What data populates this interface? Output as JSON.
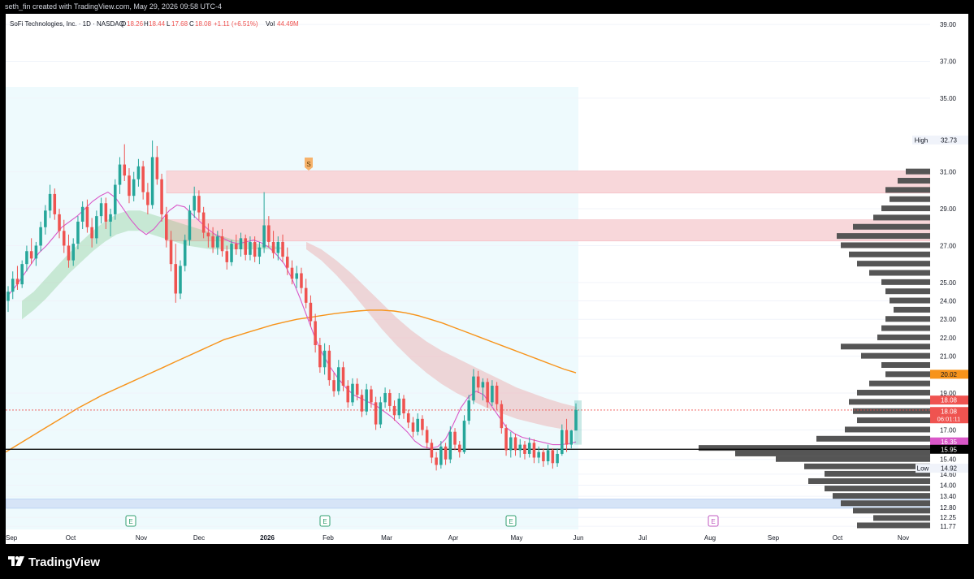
{
  "topbar": {
    "credit": "seth_fin created with TradingView.com, May 29, 2026 09:58 UTC-4"
  },
  "header": {
    "symbol": "SoFi Technologies, Inc. · 1D · NASDAQ",
    "o_label": "O",
    "o_value": "18.26",
    "h_label": "H",
    "h_value": "18.44",
    "l_label": "L",
    "l_value": "17.68",
    "c_label": "C",
    "c_value": "18.08",
    "change": "+1.11 (+6.51%)",
    "vol_label": "Vol",
    "vol_value": "44.49M"
  },
  "branding": {
    "logo_text": "TradingView"
  },
  "colors": {
    "up": "#26a69a",
    "down": "#ef5350",
    "ema": "#f7931a",
    "fast_ma": "#d957c8",
    "volume_profile": "#555555",
    "support_line": "#000000",
    "resistance_zone": "#f8d7da",
    "demand_zone": "#d6e4f7",
    "highlight_bg": "#eefafd"
  },
  "chart_data": {
    "type": "candlestick",
    "title": "SoFi Technologies, Inc. · 1D · NASDAQ",
    "y_ticks": [
      "39.00",
      "37.00",
      "35.00",
      "31.00",
      "29.00",
      "27.00",
      "25.00",
      "24.00",
      "23.00",
      "22.00",
      "21.00",
      "19.00",
      "17.00",
      "15.40",
      "14.60",
      "14.00",
      "13.40",
      "12.80",
      "12.25",
      "11.77"
    ],
    "x_ticks": [
      "Sep",
      "Oct",
      "Nov",
      "Dec",
      "2026",
      "Feb",
      "Mar",
      "Apr",
      "May",
      "Jun",
      "Jul",
      "Aug",
      "Sep",
      "Oct",
      "Nov"
    ],
    "ylim": [
      11.6,
      39.4
    ],
    "price_labels": {
      "high_label": "High",
      "high_value": "32.73",
      "low_label": "Low",
      "low_value": "14.92",
      "ema_value": "20.02",
      "last_price": "18.08",
      "last_price_2": "18.08",
      "countdown": "06:01:11",
      "fast_ma_value": "16.35",
      "support_value": "15.95"
    },
    "support_level": 15.95,
    "resistance_zones": [
      [
        29.85,
        31.05
      ],
      [
        27.25,
        28.4
      ]
    ],
    "demand_zone": [
      12.75,
      13.25
    ],
    "signal_marker": "S",
    "earnings_markers": [
      "E",
      "E",
      "E",
      "E"
    ],
    "candles": [
      {
        "o": 24.0,
        "h": 24.8,
        "l": 23.4,
        "c": 24.5
      },
      {
        "o": 24.5,
        "h": 25.6,
        "l": 24.1,
        "c": 25.2
      },
      {
        "o": 25.2,
        "h": 25.9,
        "l": 24.6,
        "c": 24.9
      },
      {
        "o": 24.9,
        "h": 26.2,
        "l": 24.7,
        "c": 26.0
      },
      {
        "o": 26.0,
        "h": 27.0,
        "l": 25.6,
        "c": 26.7
      },
      {
        "o": 26.7,
        "h": 27.4,
        "l": 26.0,
        "c": 26.3
      },
      {
        "o": 26.3,
        "h": 27.2,
        "l": 25.9,
        "c": 27.0
      },
      {
        "o": 27.0,
        "h": 28.3,
        "l": 26.7,
        "c": 28.0
      },
      {
        "o": 28.0,
        "h": 29.2,
        "l": 27.6,
        "c": 28.9
      },
      {
        "o": 28.9,
        "h": 30.3,
        "l": 28.5,
        "c": 29.8
      },
      {
        "o": 29.8,
        "h": 30.1,
        "l": 28.4,
        "c": 28.7
      },
      {
        "o": 28.7,
        "h": 29.0,
        "l": 27.4,
        "c": 27.8
      },
      {
        "o": 27.8,
        "h": 28.4,
        "l": 26.6,
        "c": 27.0
      },
      {
        "o": 27.0,
        "h": 27.6,
        "l": 25.8,
        "c": 26.2
      },
      {
        "o": 26.2,
        "h": 27.4,
        "l": 25.9,
        "c": 27.1
      },
      {
        "o": 27.1,
        "h": 28.6,
        "l": 26.8,
        "c": 28.3
      },
      {
        "o": 28.3,
        "h": 29.4,
        "l": 27.9,
        "c": 29.1
      },
      {
        "o": 29.1,
        "h": 29.5,
        "l": 27.7,
        "c": 28.0
      },
      {
        "o": 28.0,
        "h": 28.5,
        "l": 26.9,
        "c": 27.4
      },
      {
        "o": 27.4,
        "h": 28.9,
        "l": 27.1,
        "c": 28.6
      },
      {
        "o": 28.6,
        "h": 29.6,
        "l": 28.2,
        "c": 29.3
      },
      {
        "o": 29.3,
        "h": 29.6,
        "l": 27.9,
        "c": 28.3
      },
      {
        "o": 28.3,
        "h": 29.0,
        "l": 27.5,
        "c": 28.7
      },
      {
        "o": 28.7,
        "h": 30.6,
        "l": 28.4,
        "c": 30.3
      },
      {
        "o": 30.3,
        "h": 31.8,
        "l": 29.8,
        "c": 31.4
      },
      {
        "o": 31.4,
        "h": 32.5,
        "l": 30.5,
        "c": 30.8
      },
      {
        "o": 30.8,
        "h": 31.2,
        "l": 29.3,
        "c": 29.7
      },
      {
        "o": 29.7,
        "h": 31.0,
        "l": 29.4,
        "c": 30.6
      },
      {
        "o": 30.6,
        "h": 31.7,
        "l": 30.2,
        "c": 31.3
      },
      {
        "o": 31.3,
        "h": 31.6,
        "l": 29.5,
        "c": 29.9
      },
      {
        "o": 29.9,
        "h": 30.4,
        "l": 28.7,
        "c": 29.2
      },
      {
        "o": 29.2,
        "h": 32.7,
        "l": 29.0,
        "c": 31.8
      },
      {
        "o": 31.8,
        "h": 32.4,
        "l": 30.3,
        "c": 30.6
      },
      {
        "o": 30.6,
        "h": 30.9,
        "l": 28.3,
        "c": 28.7
      },
      {
        "o": 28.7,
        "h": 29.1,
        "l": 26.9,
        "c": 27.3
      },
      {
        "o": 27.3,
        "h": 27.8,
        "l": 25.6,
        "c": 26.0
      },
      {
        "o": 26.0,
        "h": 27.1,
        "l": 23.9,
        "c": 24.4
      },
      {
        "o": 24.4,
        "h": 26.2,
        "l": 24.1,
        "c": 25.9
      },
      {
        "o": 25.9,
        "h": 27.6,
        "l": 25.6,
        "c": 27.3
      },
      {
        "o": 27.3,
        "h": 29.2,
        "l": 27.0,
        "c": 28.9
      },
      {
        "o": 28.9,
        "h": 30.2,
        "l": 28.5,
        "c": 29.7
      },
      {
        "o": 29.7,
        "h": 30.0,
        "l": 28.4,
        "c": 28.8
      },
      {
        "o": 28.8,
        "h": 29.1,
        "l": 27.4,
        "c": 27.7
      },
      {
        "o": 27.7,
        "h": 28.2,
        "l": 26.9,
        "c": 27.5
      },
      {
        "o": 27.5,
        "h": 28.0,
        "l": 26.6,
        "c": 26.9
      },
      {
        "o": 26.9,
        "h": 27.8,
        "l": 26.5,
        "c": 27.5
      },
      {
        "o": 27.5,
        "h": 27.9,
        "l": 26.4,
        "c": 26.7
      },
      {
        "o": 26.7,
        "h": 27.0,
        "l": 25.7,
        "c": 26.1
      },
      {
        "o": 26.1,
        "h": 27.3,
        "l": 25.9,
        "c": 27.1
      },
      {
        "o": 27.1,
        "h": 27.6,
        "l": 26.5,
        "c": 26.8
      },
      {
        "o": 26.8,
        "h": 27.7,
        "l": 26.4,
        "c": 27.4
      },
      {
        "o": 27.4,
        "h": 27.6,
        "l": 26.2,
        "c": 26.5
      },
      {
        "o": 26.5,
        "h": 27.5,
        "l": 26.2,
        "c": 27.2
      },
      {
        "o": 27.2,
        "h": 27.5,
        "l": 26.1,
        "c": 26.4
      },
      {
        "o": 26.4,
        "h": 27.2,
        "l": 26.0,
        "c": 26.9
      },
      {
        "o": 26.9,
        "h": 29.9,
        "l": 26.6,
        "c": 28.1
      },
      {
        "o": 28.1,
        "h": 28.6,
        "l": 26.9,
        "c": 27.2
      },
      {
        "o": 27.2,
        "h": 27.8,
        "l": 26.3,
        "c": 26.6
      },
      {
        "o": 26.6,
        "h": 27.5,
        "l": 26.2,
        "c": 27.2
      },
      {
        "o": 27.2,
        "h": 27.6,
        "l": 26.1,
        "c": 26.4
      },
      {
        "o": 26.4,
        "h": 26.9,
        "l": 25.4,
        "c": 25.8
      },
      {
        "o": 25.8,
        "h": 26.2,
        "l": 24.9,
        "c": 25.2
      },
      {
        "o": 25.2,
        "h": 25.9,
        "l": 24.7,
        "c": 25.5
      },
      {
        "o": 25.5,
        "h": 25.8,
        "l": 24.4,
        "c": 24.7
      },
      {
        "o": 24.7,
        "h": 25.2,
        "l": 23.6,
        "c": 23.9
      },
      {
        "o": 23.9,
        "h": 24.3,
        "l": 22.6,
        "c": 22.9
      },
      {
        "o": 22.9,
        "h": 23.3,
        "l": 21.2,
        "c": 21.6
      },
      {
        "o": 21.6,
        "h": 22.0,
        "l": 20.1,
        "c": 20.4
      },
      {
        "o": 20.4,
        "h": 21.7,
        "l": 20.0,
        "c": 21.3
      },
      {
        "o": 21.3,
        "h": 21.6,
        "l": 19.4,
        "c": 19.7
      },
      {
        "o": 19.7,
        "h": 20.1,
        "l": 18.8,
        "c": 19.1
      },
      {
        "o": 19.1,
        "h": 20.8,
        "l": 18.9,
        "c": 20.4
      },
      {
        "o": 20.4,
        "h": 20.7,
        "l": 19.1,
        "c": 19.4
      },
      {
        "o": 19.4,
        "h": 19.7,
        "l": 18.2,
        "c": 18.5
      },
      {
        "o": 18.5,
        "h": 19.8,
        "l": 18.3,
        "c": 19.5
      },
      {
        "o": 19.5,
        "h": 19.8,
        "l": 18.6,
        "c": 18.9
      },
      {
        "o": 18.9,
        "h": 19.2,
        "l": 17.7,
        "c": 18.0
      },
      {
        "o": 18.0,
        "h": 19.5,
        "l": 17.8,
        "c": 19.2
      },
      {
        "o": 19.2,
        "h": 19.4,
        "l": 18.2,
        "c": 18.5
      },
      {
        "o": 18.5,
        "h": 18.8,
        "l": 17.0,
        "c": 17.3
      },
      {
        "o": 17.3,
        "h": 18.8,
        "l": 17.1,
        "c": 18.5
      },
      {
        "o": 18.5,
        "h": 19.3,
        "l": 18.2,
        "c": 19.0
      },
      {
        "o": 19.0,
        "h": 19.2,
        "l": 18.0,
        "c": 18.3
      },
      {
        "o": 18.3,
        "h": 18.6,
        "l": 17.5,
        "c": 17.8
      },
      {
        "o": 17.8,
        "h": 19.0,
        "l": 17.6,
        "c": 18.7
      },
      {
        "o": 18.7,
        "h": 18.9,
        "l": 17.6,
        "c": 17.9
      },
      {
        "o": 17.9,
        "h": 18.1,
        "l": 17.1,
        "c": 17.4
      },
      {
        "o": 17.4,
        "h": 17.7,
        "l": 16.6,
        "c": 16.9
      },
      {
        "o": 16.9,
        "h": 17.9,
        "l": 16.7,
        "c": 17.6
      },
      {
        "o": 17.6,
        "h": 17.8,
        "l": 16.7,
        "c": 17.0
      },
      {
        "o": 17.0,
        "h": 17.2,
        "l": 16.0,
        "c": 16.3
      },
      {
        "o": 16.3,
        "h": 16.5,
        "l": 15.2,
        "c": 15.5
      },
      {
        "o": 15.5,
        "h": 15.8,
        "l": 14.8,
        "c": 15.1
      },
      {
        "o": 15.1,
        "h": 16.4,
        "l": 14.9,
        "c": 16.1
      },
      {
        "o": 16.1,
        "h": 16.3,
        "l": 15.1,
        "c": 15.4
      },
      {
        "o": 15.4,
        "h": 17.2,
        "l": 15.2,
        "c": 16.9
      },
      {
        "o": 16.9,
        "h": 17.1,
        "l": 15.9,
        "c": 16.2
      },
      {
        "o": 16.2,
        "h": 16.4,
        "l": 15.5,
        "c": 15.8
      },
      {
        "o": 15.8,
        "h": 17.8,
        "l": 15.7,
        "c": 17.5
      },
      {
        "o": 17.5,
        "h": 18.9,
        "l": 17.3,
        "c": 18.6
      },
      {
        "o": 18.6,
        "h": 20.3,
        "l": 18.4,
        "c": 19.9
      },
      {
        "o": 19.9,
        "h": 20.2,
        "l": 19.0,
        "c": 19.3
      },
      {
        "o": 19.3,
        "h": 19.8,
        "l": 18.6,
        "c": 19.6
      },
      {
        "o": 19.6,
        "h": 19.8,
        "l": 18.2,
        "c": 18.5
      },
      {
        "o": 18.5,
        "h": 19.7,
        "l": 18.3,
        "c": 19.4
      },
      {
        "o": 19.4,
        "h": 19.6,
        "l": 18.1,
        "c": 18.4
      },
      {
        "o": 18.4,
        "h": 18.6,
        "l": 16.8,
        "c": 17.1
      },
      {
        "o": 17.1,
        "h": 17.3,
        "l": 15.6,
        "c": 15.9
      },
      {
        "o": 15.9,
        "h": 16.9,
        "l": 15.5,
        "c": 16.6
      },
      {
        "o": 16.6,
        "h": 16.8,
        "l": 15.6,
        "c": 15.9
      },
      {
        "o": 15.9,
        "h": 16.5,
        "l": 15.5,
        "c": 16.2
      },
      {
        "o": 16.2,
        "h": 16.4,
        "l": 15.4,
        "c": 15.7
      },
      {
        "o": 15.7,
        "h": 16.6,
        "l": 15.5,
        "c": 16.3
      },
      {
        "o": 16.3,
        "h": 16.5,
        "l": 15.2,
        "c": 15.5
      },
      {
        "o": 15.5,
        "h": 16.1,
        "l": 15.2,
        "c": 15.8
      },
      {
        "o": 15.8,
        "h": 16.0,
        "l": 15.0,
        "c": 15.3
      },
      {
        "o": 15.3,
        "h": 16.2,
        "l": 15.1,
        "c": 15.9
      },
      {
        "o": 15.9,
        "h": 16.0,
        "l": 14.9,
        "c": 15.2
      },
      {
        "o": 15.2,
        "h": 16.0,
        "l": 15.0,
        "c": 15.7
      },
      {
        "o": 15.7,
        "h": 17.3,
        "l": 15.6,
        "c": 17.0
      },
      {
        "o": 17.0,
        "h": 17.6,
        "l": 15.8,
        "c": 16.2
      },
      {
        "o": 16.2,
        "h": 17.0,
        "l": 16.0,
        "c": 16.97
      },
      {
        "o": 16.97,
        "h": 18.44,
        "l": 17.68,
        "c": 18.08
      }
    ],
    "ema_200": [
      15.8,
      16.2,
      16.6,
      17.0,
      17.4,
      17.8,
      18.2,
      18.55,
      18.9,
      19.2,
      19.5,
      19.8,
      20.1,
      20.4,
      20.7,
      21.0,
      21.3,
      21.6,
      21.9,
      22.1,
      22.3,
      22.5,
      22.7,
      22.85,
      23.0,
      23.1,
      23.2,
      23.3,
      23.38,
      23.45,
      23.5,
      23.5,
      23.45,
      23.35,
      23.2,
      23.0,
      22.8,
      22.55,
      22.3,
      22.05,
      21.8,
      21.55,
      21.3,
      21.05,
      20.8,
      20.55,
      20.3,
      20.1
    ],
    "fast_ma": [
      24.3,
      24.8,
      25.4,
      26.0,
      26.6,
      27.0,
      27.5,
      28.0,
      28.3,
      28.6,
      29.0,
      29.4,
      29.7,
      29.9,
      29.6,
      29.0,
      28.4,
      27.9,
      27.6,
      27.9,
      28.4,
      28.9,
      29.2,
      29.1,
      28.7,
      28.3,
      27.9,
      27.6,
      27.4,
      27.2,
      27.1,
      27.2,
      27.3,
      27.15,
      26.9,
      26.5,
      26.0,
      25.2,
      24.2,
      23.1,
      22.0,
      21.1,
      20.4,
      19.8,
      19.3,
      18.9,
      18.7,
      18.5,
      18.3,
      18.0,
      17.7,
      17.3,
      16.9,
      16.4,
      16.1,
      16.0,
      16.1,
      16.5,
      17.3,
      18.2,
      18.8,
      19.1,
      18.9,
      18.3,
      17.7,
      17.1,
      16.8,
      16.6,
      16.5,
      16.4,
      16.3,
      16.2,
      16.2,
      16.25,
      16.35
    ],
    "ribbon_green": {
      "upper": [
        24.0,
        24.5,
        25.2,
        25.9,
        26.6,
        27.2,
        27.8,
        28.3,
        28.7,
        28.9,
        28.9,
        28.7,
        28.5,
        28.3,
        28.1,
        27.9,
        27.7,
        27.5,
        27.3,
        27.2,
        27.1,
        27.0,
        26.9
      ],
      "lower": [
        23.0,
        23.5,
        24.1,
        24.8,
        25.5,
        26.1,
        26.7,
        27.2,
        27.6,
        27.8,
        27.8,
        27.6,
        27.4,
        27.2,
        27.0,
        26.9,
        26.8,
        26.8,
        26.8,
        26.8,
        26.8,
        26.8,
        26.8
      ]
    },
    "ribbon_red": {
      "upper": [
        27.2,
        26.8,
        26.2,
        25.5,
        24.7,
        23.9,
        23.1,
        22.4,
        21.8,
        21.3,
        20.9,
        20.5,
        20.1,
        19.7,
        19.3,
        19.0,
        18.7,
        18.45,
        18.25
      ],
      "lower": [
        26.8,
        26.2,
        25.4,
        24.5,
        23.5,
        22.5,
        21.6,
        20.8,
        20.1,
        19.5,
        19.0,
        18.6,
        18.2,
        17.9,
        17.6,
        17.4,
        17.2,
        17.05,
        16.95
      ]
    },
    "volume_profile": [
      {
        "p": 31.0,
        "w": 30
      },
      {
        "p": 30.5,
        "w": 40
      },
      {
        "p": 30.0,
        "w": 55
      },
      {
        "p": 29.5,
        "w": 50
      },
      {
        "p": 29.0,
        "w": 60
      },
      {
        "p": 28.5,
        "w": 70
      },
      {
        "p": 28.0,
        "w": 95
      },
      {
        "p": 27.5,
        "w": 115
      },
      {
        "p": 27.0,
        "w": 110
      },
      {
        "p": 26.5,
        "w": 100
      },
      {
        "p": 26.0,
        "w": 90
      },
      {
        "p": 25.5,
        "w": 75
      },
      {
        "p": 25.0,
        "w": 60
      },
      {
        "p": 24.5,
        "w": 55
      },
      {
        "p": 24.0,
        "w": 50
      },
      {
        "p": 23.5,
        "w": 45
      },
      {
        "p": 23.0,
        "w": 55
      },
      {
        "p": 22.5,
        "w": 60
      },
      {
        "p": 22.0,
        "w": 65
      },
      {
        "p": 21.5,
        "w": 110
      },
      {
        "p": 21.0,
        "w": 85
      },
      {
        "p": 20.5,
        "w": 60
      },
      {
        "p": 20.0,
        "w": 55
      },
      {
        "p": 19.5,
        "w": 75
      },
      {
        "p": 19.0,
        "w": 90
      },
      {
        "p": 18.5,
        "w": 100
      },
      {
        "p": 18.0,
        "w": 95
      },
      {
        "p": 17.5,
        "w": 90
      },
      {
        "p": 17.0,
        "w": 105
      },
      {
        "p": 16.5,
        "w": 140
      },
      {
        "p": 16.0,
        "w": 285
      },
      {
        "p": 15.7,
        "w": 240
      },
      {
        "p": 15.4,
        "w": 190
      },
      {
        "p": 15.0,
        "w": 155
      },
      {
        "p": 14.6,
        "w": 130
      },
      {
        "p": 14.2,
        "w": 150
      },
      {
        "p": 13.8,
        "w": 130
      },
      {
        "p": 13.4,
        "w": 120
      },
      {
        "p": 13.0,
        "w": 110
      },
      {
        "p": 12.6,
        "w": 95
      },
      {
        "p": 12.2,
        "w": 70
      },
      {
        "p": 11.8,
        "w": 90
      }
    ]
  }
}
